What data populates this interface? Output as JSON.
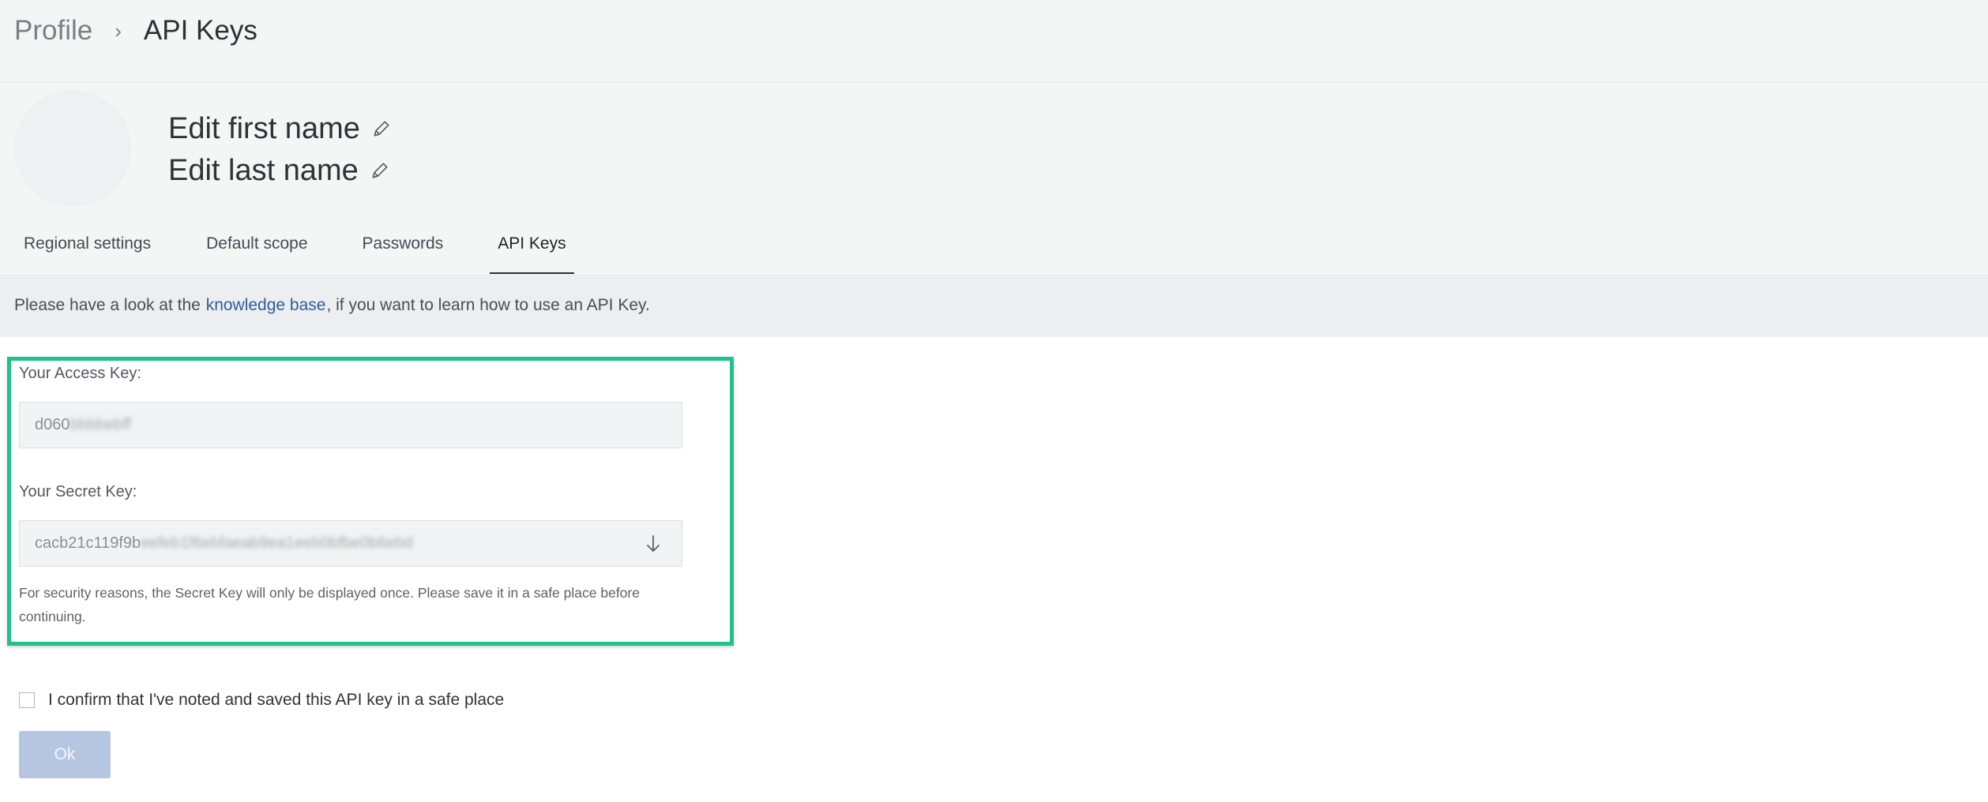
{
  "breadcrumb": {
    "parent": "Profile",
    "separator": "›",
    "current": "API Keys"
  },
  "profile": {
    "first_name_placeholder": "Edit first name",
    "last_name_placeholder": "Edit last name"
  },
  "tabs": [
    {
      "label": "Regional settings",
      "active": false
    },
    {
      "label": "Default scope",
      "active": false
    },
    {
      "label": "Passwords",
      "active": false
    },
    {
      "label": "API Keys",
      "active": true
    }
  ],
  "info": {
    "prefix": "Please have a look at the",
    "link": "knowledge base",
    "suffix": ", if you want to learn how to use an API Key."
  },
  "keys": {
    "access_label": "Your Access Key:",
    "access_visible": "d060",
    "access_obscured": "bbbbebff",
    "secret_label": "Your Secret Key:",
    "secret_visible": "cacb21c119f9b",
    "secret_obscured": "eefeb1f6ebfaeab9ea1eeb0bfbe0b6ebd",
    "note": "For security reasons, the Secret Key will only be displayed once. Please save it in a safe place before continuing."
  },
  "confirm": {
    "label": "I confirm that I've noted and saved this API key in a safe place",
    "checked": false
  },
  "actions": {
    "ok_label": "Ok",
    "ok_disabled": true
  },
  "colors": {
    "highlight_border": "#22c08c",
    "link": "#2f5e97",
    "ok_button_bg": "#b7c6e0",
    "header_bg": "#f4f5f5",
    "info_bar_bg": "#eceef2"
  },
  "icons": {
    "edit": "pencil-icon",
    "download": "arrow-down-icon",
    "breadcrumb_separator": "chevron-right-icon"
  }
}
